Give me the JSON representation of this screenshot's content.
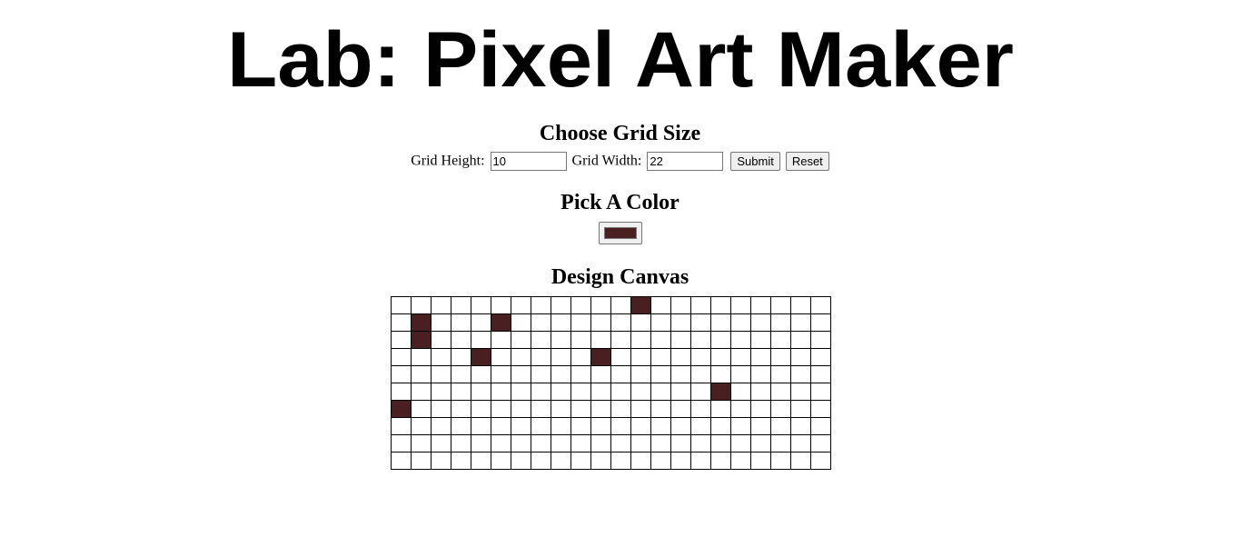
{
  "title": {
    "text": "Lab: Pixel Art Maker"
  },
  "grid_section": {
    "heading": "Choose Grid Size",
    "height_label": "Grid Height:",
    "height_value": "10",
    "width_label": "Grid Width:",
    "width_value": "22",
    "submit_label": "Submit",
    "reset_label": "Reset"
  },
  "color_section": {
    "heading": "Pick A Color",
    "selected_color": "#4a1f22"
  },
  "canvas_section": {
    "heading": "Design Canvas",
    "rows": 10,
    "cols": 22,
    "grid_line_color": "#000000",
    "empty_color": "#ffffff",
    "filled_cells": [
      {
        "row": 0,
        "col": 12
      },
      {
        "row": 1,
        "col": 1
      },
      {
        "row": 1,
        "col": 5
      },
      {
        "row": 2,
        "col": 1
      },
      {
        "row": 3,
        "col": 4
      },
      {
        "row": 3,
        "col": 10
      },
      {
        "row": 5,
        "col": 16
      },
      {
        "row": 6,
        "col": 0
      }
    ]
  }
}
